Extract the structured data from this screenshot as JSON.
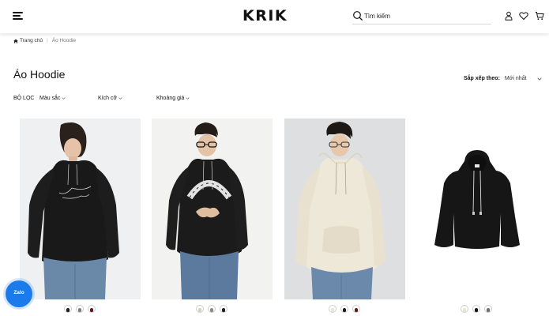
{
  "header": {
    "logo": "KRIK",
    "search_placeholder": "Tìm kiếm"
  },
  "breadcrumb": {
    "home": "Trang chủ",
    "current": "Áo Hoodie"
  },
  "page_title": "Áo Hoodie",
  "sort": {
    "label": "Sắp xếp theo:",
    "value": "Mới nhất"
  },
  "filters": {
    "title": "BỘ LỌC",
    "items": [
      "Màu sắc",
      "Kích cỡ",
      "Khoảng giá"
    ]
  },
  "products": [
    {
      "swatches": [
        "#1c1c1c",
        "#7d7d76",
        "#5b1a20"
      ]
    },
    {
      "swatches": [
        "#d8d0bd",
        "#8b8b80",
        "#1f1f1f"
      ]
    },
    {
      "swatches": [
        "#ece5d2",
        "#1b1b1b",
        "#5a1d22"
      ]
    },
    {
      "swatches": [
        "#e8e2d2",
        "#161616",
        "#6f6f6f"
      ]
    }
  ],
  "colors": {
    "zalo": "#1b7bea",
    "text": "#111111"
  },
  "zalo": {
    "label": "Zalo"
  }
}
